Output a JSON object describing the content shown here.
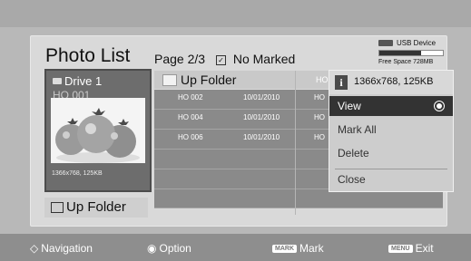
{
  "header": {
    "title": "Photo List",
    "page": "Page 2/3",
    "marked": "No Marked"
  },
  "usb": {
    "label": "USB Device",
    "free_space": "Free Space 728MB",
    "usage_fraction": 0.65
  },
  "preview": {
    "drive": "Drive 1",
    "file": "HO 001",
    "resolution": "1366x768, 125KB"
  },
  "up_folder_left": "Up Folder",
  "list": {
    "head_label": "Up Folder",
    "head_right": "HO",
    "rows": [
      {
        "name": "HO 002",
        "date": "10/01/2010",
        "name2": "HO"
      },
      {
        "name": "HO 004",
        "date": "10/01/2010",
        "name2": "HO"
      },
      {
        "name": "HO 006",
        "date": "10/01/2010",
        "name2": "HO"
      }
    ]
  },
  "options": {
    "info": "1366x768, 125KB",
    "items": [
      "View",
      "Mark All",
      "Delete",
      "Close"
    ],
    "selected": "View"
  },
  "footer": {
    "navigation": "Navigation",
    "option": "Option",
    "mark_badge": "MARK",
    "mark": "Mark",
    "exit_badge": "MENU",
    "exit": "Exit"
  },
  "icons": [
    "usb-icon",
    "folder-icon",
    "info-icon",
    "radio-selected-icon",
    "navigation-icon",
    "option-icon"
  ]
}
